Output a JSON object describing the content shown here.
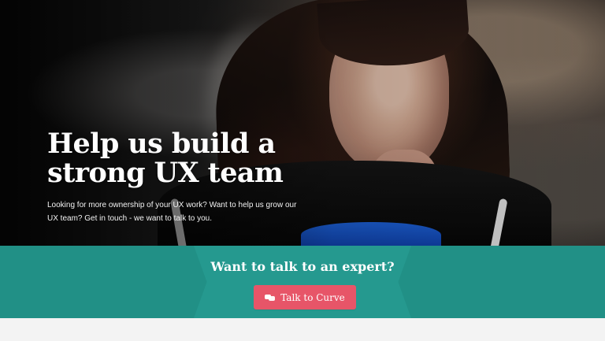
{
  "hero": {
    "title": "Help us build a\nstrong UX team",
    "subtext": "Looking for more ownership of your UX work? Want to help us grow our UX team? Get in touch - we want to talk to you."
  },
  "cta": {
    "heading": "Want to talk to an expert?",
    "button_label": "Talk to Curve",
    "button_icon": "chat-icon"
  },
  "colors": {
    "teal_band": "#219086",
    "teal_center": "#25998f",
    "button": "#e75568",
    "footer_strip": "#f3f3f3",
    "text_light": "#ffffff"
  }
}
